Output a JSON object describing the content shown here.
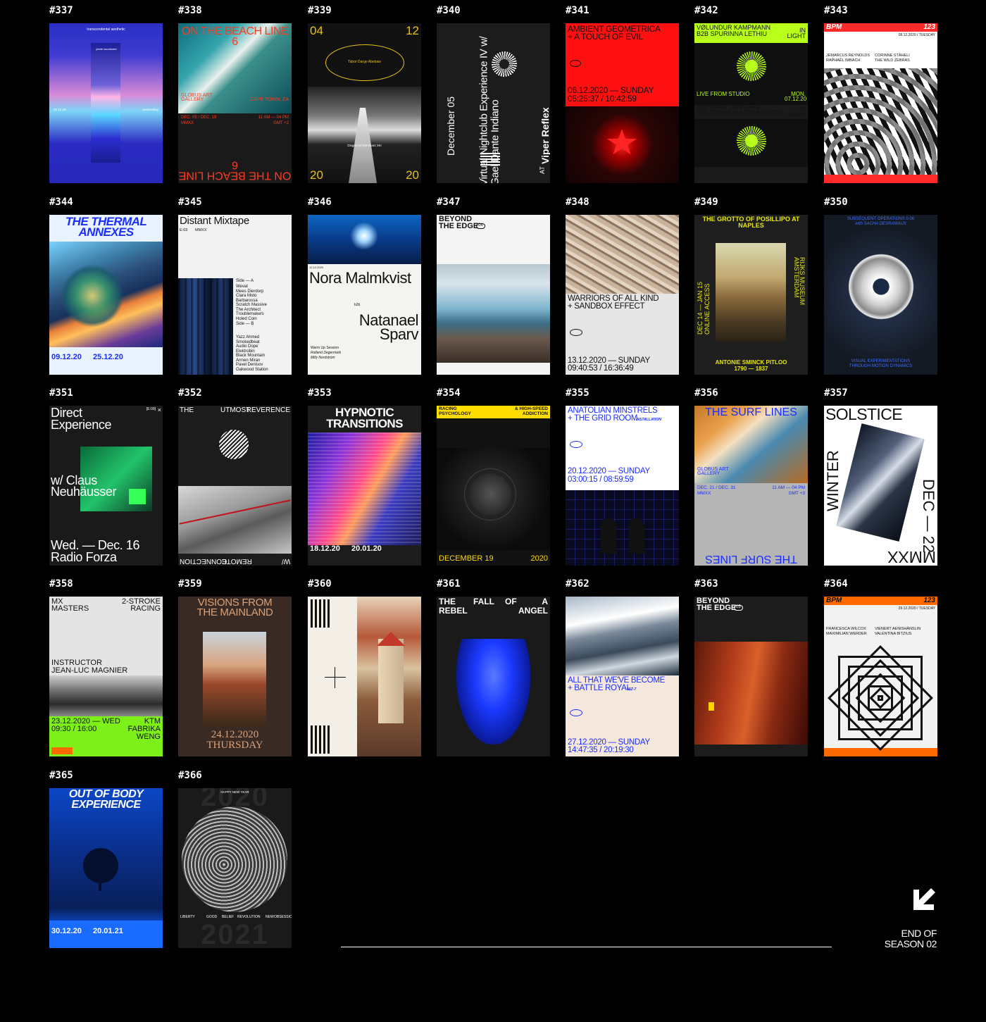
{
  "footer": {
    "end_line1": "END OF",
    "end_line2": "SEASON 02"
  },
  "posters": [
    {
      "id": "#337",
      "bg": "#2628b8",
      "fg": "#fff",
      "texts": [
        "transcendental aesthetic",
        "jamie woodward",
        "02.12.20",
        "wednesday"
      ],
      "style": "gradient"
    },
    {
      "id": "#338",
      "bg": "#1a1a1a",
      "fg": "#ff3b1f",
      "texts": [
        "ON THE BEACH LINE 6",
        "GLOBUS ART GALLERY",
        "CAPE TOWN, ZA",
        "DEC. 05 / DEC. 19",
        "11 AM — 04 PM",
        "MMXX",
        "GMT +2"
      ],
      "style": "beach"
    },
    {
      "id": "#339",
      "bg": "#111",
      "fg": "#e8c21b",
      "texts": [
        "04",
        "12",
        "20",
        "20",
        "Tabor Darge Abebaw",
        "Disgraced Merchant XIII"
      ],
      "style": "road"
    },
    {
      "id": "#340",
      "bg": "#1c1c1c",
      "fg": "#fff",
      "texts": [
        "Virtual Nightclub Experience IV w/ Gael Dante Indiano",
        "December 05",
        "AT",
        "Viper Reflex"
      ],
      "style": "vertical"
    },
    {
      "id": "#341",
      "bg": "#ff1010",
      "fg": "#111",
      "texts": [
        "AMBIENT GEOMETRICA",
        "+ A TOUCH OF EVIL",
        "06.12.2020 — SUNDAY",
        "05:25:37 / 10:42:59"
      ],
      "style": "redstar"
    },
    {
      "id": "#342",
      "bg": "#b8ff1a",
      "fg": "#111",
      "texts": [
        "VØLUNDUR KAMPMANN",
        "B2B SPURINNA LETHIU",
        "IN LIGHT",
        "LIVE FROM STUDIO",
        "MON. 07.12.20",
        "VERISIMA VERDUGO",
        "B2B FRANKIE MCPHERSON",
        "IN DARK"
      ],
      "style": "neon"
    },
    {
      "id": "#343",
      "bg": "#fff",
      "fg": "#111",
      "texts": [
        "BPM",
        "123",
        "08.12.2020 / TUESDAY",
        "JEMARCUS REYNOLDS",
        "CORINNE STÄHELI",
        "RAPHAËL IMBACH",
        "THE WILD ZEBRAS"
      ],
      "style": "zebra"
    },
    {
      "id": "#344",
      "bg": "#e8f3ff",
      "fg": "#1b2dff",
      "texts": [
        "THE THERMAL ANNEXES",
        "09.12.20",
        "25.12.20"
      ],
      "style": "thermal"
    },
    {
      "id": "#345",
      "bg": "#f2f2f2",
      "fg": "#111",
      "texts": [
        "Distant Mixtape",
        "E:03",
        "MMXX",
        "Side — A",
        "Side — B",
        "Wevat",
        "Mees Dierdorp",
        "Clara Moto",
        "Barbarossa",
        "Scratch Massive",
        "The Architect",
        "Troublemakers",
        "Holed Coin",
        "Yazz Ahmed",
        "Smokedbeat",
        "Audio Dope",
        "Elektrobin",
        "Black Mountain",
        "Armen Miran",
        "Pavel Denisov",
        "Oakwood Station"
      ],
      "style": "mixtape"
    },
    {
      "id": "#346",
      "bg": "#f4f4f0",
      "fg": "#111",
      "texts": [
        "Nora Malmkvist",
        "b2b",
        "Natanael Sparv",
        "12.12.2020",
        "Warm Up Session",
        "Rolland Degermark",
        "Milly Nordström"
      ],
      "style": "nora"
    },
    {
      "id": "#347",
      "bg": "#f4f4f4",
      "fg": "#111",
      "texts": [
        "BEYOND THE EDGE",
        "04"
      ],
      "style": "glacier"
    },
    {
      "id": "#348",
      "bg": "#e6e6e6",
      "fg": "#111",
      "texts": [
        "WARRIORS OF ALL KIND",
        "+ SANDBOX EFFECT",
        "13.12.2020 — SUNDAY",
        "09:40:53 / 16:36:49"
      ],
      "style": "sand"
    },
    {
      "id": "#349",
      "bg": "#1e1e1e",
      "fg": "#e6e611",
      "texts": [
        "THE GROTTO OF POSILLIPO AT NAPLES",
        "DEC 14 — JAN 15",
        "ONLINE ACCESS",
        "RIJKS MUSEUM AMSTERDAM",
        "ANTONIE SMINCK PITLOO",
        "1790 — 1837"
      ],
      "style": "painting"
    },
    {
      "id": "#350",
      "bg": "#14181e",
      "fg": "#3d6cff",
      "texts": [
        "SUBSEQUENT OPERATIONS 0.06",
        "with SACHA DESRAMAUX",
        "VISUAL EXPERIMENTATIONS",
        "THROUGH MOTION DYNAMICS"
      ],
      "style": "ring"
    },
    {
      "id": "#351",
      "bg": "#1a1a1a",
      "fg": "#fff",
      "texts": [
        "Direct Experience",
        "[E:09]",
        "w/ Claus",
        "Neuhäusser",
        "Wed. — Dec. 16",
        "Radio Forza"
      ],
      "style": "direct"
    },
    {
      "id": "#352",
      "bg": "#1c1c1c",
      "fg": "#fff",
      "texts": [
        "THE",
        "UTMOST",
        "REVERENCE",
        "W/",
        "REMOTE",
        "CONNECTION"
      ],
      "style": "reverence"
    },
    {
      "id": "#353",
      "bg": "#1c1c1c",
      "fg": "#fff",
      "texts": [
        "HYPNOTIC",
        "TRANSITIONS",
        "18.12.20",
        "20.01.20"
      ],
      "style": "hypnotic"
    },
    {
      "id": "#354",
      "bg": "#111",
      "fg": "#ffdd00",
      "texts": [
        "RACING PSYCHOLOGY",
        "& HIGH-SPEED ADDICTION",
        "DECEMBER 19",
        "2020"
      ],
      "style": "racing"
    },
    {
      "id": "#355",
      "bg": "#fff",
      "fg": "#1b2dff",
      "texts": [
        "ANATOLIAN MINSTRELS",
        "+ THE GRID ROOM",
        "INSTALLATION",
        "20.12.2020 — SUNDAY",
        "03:00:15 / 08:59:59"
      ],
      "style": "grid"
    },
    {
      "id": "#356",
      "bg": "#b5b5b5",
      "fg": "#1b2dff",
      "texts": [
        "THE SURF LINES",
        "GLOBUS ART GALLERY",
        "DEC. 21 / DEC. 31",
        "11 AM — 04 PM",
        "MMXX",
        "GMT +3",
        "THE SURF LINES"
      ],
      "style": "surf"
    },
    {
      "id": "#357",
      "bg": "#fff",
      "fg": "#111",
      "texts": [
        "SOLSTICE",
        "WINTER",
        "DEC — 22",
        "MMXX"
      ],
      "style": "solstice"
    },
    {
      "id": "#358",
      "bg": "#e4e4e4",
      "fg": "#111",
      "texts": [
        "MX MASTERS",
        "2-STROKE RACING",
        "INSTRUCTOR",
        "JEAN-LUC MAGNIER",
        "23.12.2020 — WED",
        "KTM",
        "09:30 / 16:00",
        "FABRIKA",
        "WENG"
      ],
      "style": "mx"
    },
    {
      "id": "#359",
      "bg": "#3a2a24",
      "fg": "#d9a27a",
      "texts": [
        "VISIONS FROM",
        "THE MAINLAND",
        "24.12.2020",
        "THURSDAY"
      ],
      "style": "visions"
    },
    {
      "id": "#360",
      "bg": "#f4efe6",
      "fg": "#111",
      "texts": [],
      "style": "tower"
    },
    {
      "id": "#361",
      "bg": "#1a1a1a",
      "fg": "#fff",
      "texts": [
        "THE",
        "FALL",
        "OF",
        "A",
        "REBEL",
        "ANGEL"
      ],
      "style": "angel"
    },
    {
      "id": "#362",
      "bg": "#f4e7dc",
      "fg": "#1b2dff",
      "texts": [
        "ALL THAT WE'VE BECOME",
        "+ BATTLE ROYAL",
        "WZ-7",
        "27.12.2020 — SUNDAY",
        "14:47:35 / 20:19:30"
      ],
      "style": "mountain"
    },
    {
      "id": "#363",
      "bg": "#1c1c1c",
      "fg": "#fff",
      "texts": [
        "BEYOND THE EDGE",
        "05"
      ],
      "style": "cliff"
    },
    {
      "id": "#364",
      "bg": "#f2f2f2",
      "fg": "#111",
      "texts": [
        "BPM",
        "123",
        "29.12.2020 / TUESDAY",
        "FRANCESCA WILCOX",
        "VIENERT AENISHÄNSLIN",
        "MAXIMILIAN WERDER",
        "VALENTINA BITZIUS"
      ],
      "style": "squares"
    },
    {
      "id": "#365",
      "bg": "#0b2f8a",
      "fg": "#fff",
      "texts": [
        "OUT OF BODY",
        "EXPERIENCE",
        "30.12.20",
        "20.01.21"
      ],
      "style": "outofbody"
    },
    {
      "id": "#366",
      "bg": "#1a1a1a",
      "fg": "#fff",
      "texts": [
        "HAPPY NEW YEAR",
        "2020",
        "2021",
        "LIBERTY",
        "GOOD",
        "BELIEF",
        "REVOLUTION",
        "NEW",
        "OBSESSION"
      ],
      "style": "topo"
    }
  ]
}
